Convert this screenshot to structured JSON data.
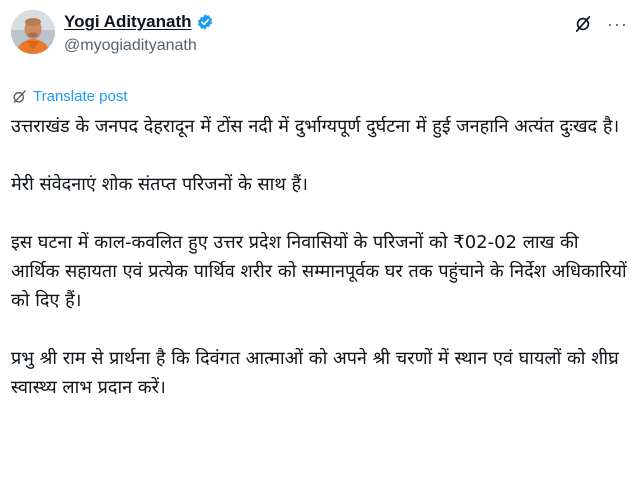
{
  "author": {
    "display_name": "Yogi Adityanath",
    "handle": "@myogiadityanath",
    "verified": true
  },
  "actions": {
    "grok_icon": "grok-icon",
    "more_label": "···"
  },
  "translate": {
    "label": "Translate post",
    "icon": "translate-icon"
  },
  "post": {
    "paragraphs": [
      "उत्तराखंड के जनपद देहरादून में टोंस नदी में दुर्भाग्यपूर्ण दुर्घटना में हुई जनहानि अत्यंत दुःखद है।",
      "मेरी संवेदनाएं शोक संतप्त परिजनों के साथ हैं।",
      "इस घटना में काल-कवलित हुए उत्तर प्रदेश निवासियों के परिजनों को ₹02-02 लाख की आर्थिक सहायता एवं प्रत्येक पार्थिव शरीर को सम्मानपूर्वक घर तक पहुंचाने के निर्देश अधिकारियों को दिए हैं।",
      "प्रभु श्री राम से प्रार्थना है कि दिवंगत आत्माओं को अपने श्री चरणों में स्थान एवं घायलों को शीघ्र स्वास्थ्य लाभ प्रदान करें।"
    ]
  },
  "colors": {
    "accent": "#1d9bf0",
    "text": "#0f1419",
    "secondary": "#536471",
    "avatar_robe": "#e8782a"
  }
}
